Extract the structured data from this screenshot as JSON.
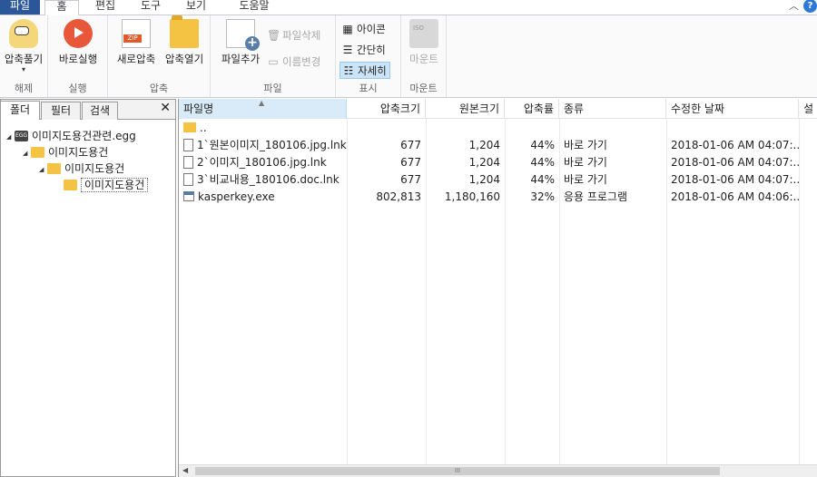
{
  "menu": {
    "tabs": [
      "파일",
      "홈",
      "편집",
      "도구",
      "보기",
      "도움말"
    ],
    "collapse_glyph": "︿",
    "help_glyph": "?"
  },
  "ribbon": {
    "groups": {
      "extract": {
        "label": "해제",
        "button": "압축풀기"
      },
      "run": {
        "label": "실행",
        "button": "바로실행"
      },
      "compress": {
        "label": "압축",
        "new_button": "새로압축",
        "open_button": "압축열기"
      },
      "file": {
        "label": "파일",
        "add_button": "파일추가",
        "delete_button": "파일삭제",
        "rename_button": "이름변경"
      },
      "view": {
        "label": "표시",
        "icons_button": "아이콘",
        "simple_button": "간단히",
        "details_button": "자세히"
      },
      "mount": {
        "label": "마운트",
        "button": "마운트"
      }
    },
    "dropdown_glyph": "▾"
  },
  "left_panel": {
    "tabs": [
      "폴더",
      "필터",
      "검색"
    ],
    "close_glyph": "✕",
    "tree": {
      "root": "이미지도용건관련.egg",
      "level1": "이미지도용건",
      "level2": "이미지도용건",
      "level3": "이미지도용건"
    }
  },
  "list": {
    "columns": {
      "name": "파일명",
      "packed": "압축크기",
      "size": "원본크기",
      "ratio": "압축률",
      "type": "종류",
      "modified": "수정한 날짜",
      "extra": "설"
    },
    "rows": [
      {
        "name": "..",
        "packed": "",
        "size": "",
        "ratio": "",
        "type": "",
        "modified": "",
        "icon": "folder-icon"
      },
      {
        "name": "1`원본이미지_180106.jpg.lnk",
        "packed": "677",
        "size": "1,204",
        "ratio": "44%",
        "type": "바로 가기",
        "modified": "2018-01-06 AM 04:07:...",
        "icon": "shortcut-file-icon"
      },
      {
        "name": "2`이미지_180106.jpg.lnk",
        "packed": "677",
        "size": "1,204",
        "ratio": "44%",
        "type": "바로 가기",
        "modified": "2018-01-06 AM 04:07:...",
        "icon": "shortcut-file-icon"
      },
      {
        "name": "3`비교내용_180106.doc.lnk",
        "packed": "677",
        "size": "1,204",
        "ratio": "44%",
        "type": "바로 가기",
        "modified": "2018-01-06 AM 04:07:...",
        "icon": "shortcut-file-icon"
      },
      {
        "name": "kasperkey.exe",
        "packed": "802,813",
        "size": "1,180,160",
        "ratio": "32%",
        "type": "응용 프로그램",
        "modified": "2018-01-06 AM 04:06:...",
        "icon": "application-icon"
      }
    ]
  },
  "scrollbar": {
    "thumb_grip": "III",
    "left_arrow": "◀"
  },
  "colors": {
    "accent": "#2b579a",
    "selection": "#cce4f7",
    "folder": "#f4c343"
  }
}
